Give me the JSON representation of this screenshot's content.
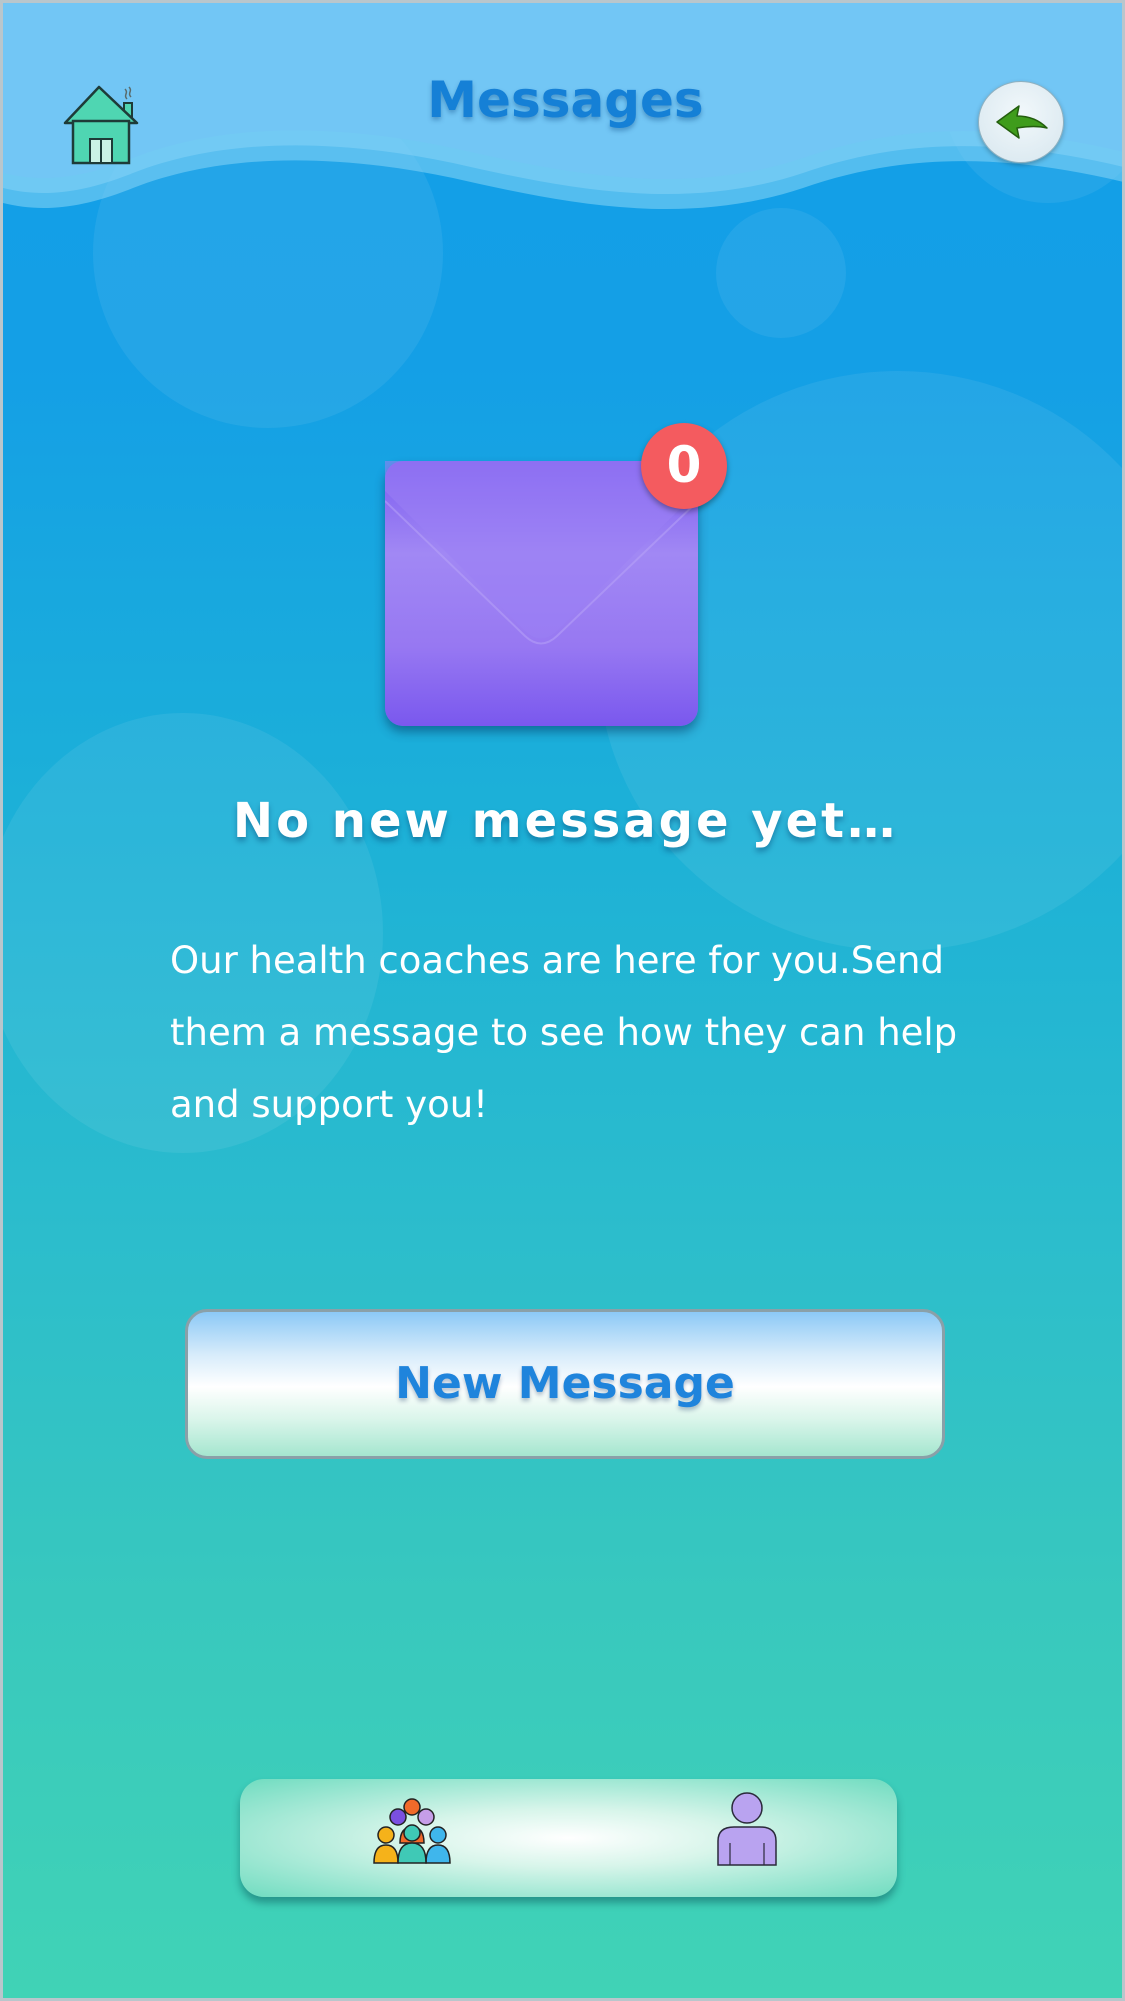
{
  "header": {
    "title": "Messages",
    "home_icon": "home-icon",
    "back_icon": "back-arrow-icon"
  },
  "inbox": {
    "unread_count": "0",
    "empty_title": "No new message yet…",
    "empty_body": "Our health coaches are here for you.Send them a message to see how they can help and support you!"
  },
  "actions": {
    "new_message_label": "New Message"
  },
  "tabbar": {
    "items": [
      {
        "icon": "community-icon"
      },
      {
        "icon": "profile-icon"
      }
    ]
  },
  "colors": {
    "title": "#1580d6",
    "badge": "#f45b5f",
    "envelope": "#8a6cf2",
    "button_text": "#1f84dc"
  }
}
